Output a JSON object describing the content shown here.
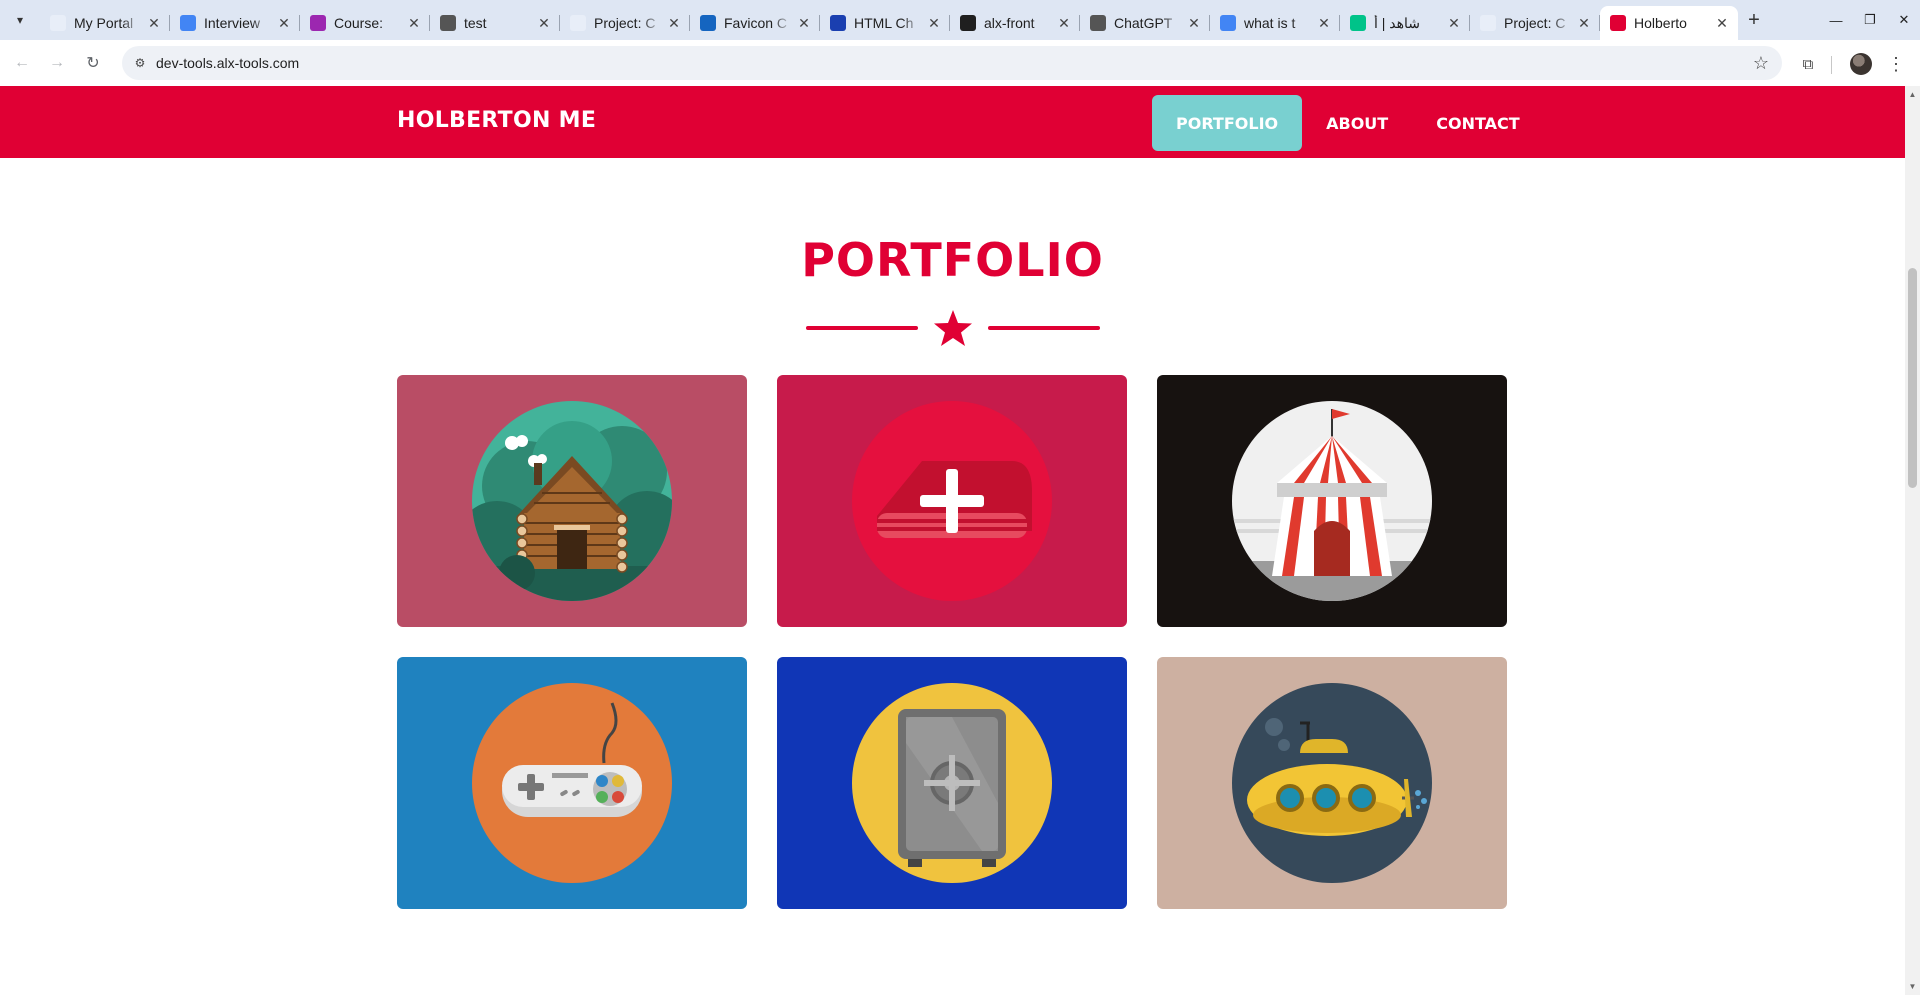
{
  "browser": {
    "tabs": [
      {
        "title": "My Portal",
        "favicon": "alx-icon",
        "color": "#e8eef8"
      },
      {
        "title": "Interview",
        "favicon": "google-icon",
        "color": "#4285f4"
      },
      {
        "title": "Course: ",
        "favicon": "course-icon",
        "color": "#9c27b0"
      },
      {
        "title": "test",
        "favicon": "globe-icon",
        "color": "#555555"
      },
      {
        "title": "Project: C",
        "favicon": "alx-icon",
        "color": "#e8eef8"
      },
      {
        "title": "Favicon C",
        "favicon": "favicon-icon",
        "color": "#1565c0"
      },
      {
        "title": "HTML Ch",
        "favicon": "html-icon",
        "color": "#1a3fb0"
      },
      {
        "title": "alx-front",
        "favicon": "github-icon",
        "color": "#1f1f1f"
      },
      {
        "title": "ChatGPT",
        "favicon": "chatgpt-icon",
        "color": "#555555"
      },
      {
        "title": "what is t",
        "favicon": "google-icon",
        "color": "#4285f4"
      },
      {
        "title": "شاهد | أ",
        "favicon": "shahid-icon",
        "color": "#00c389"
      },
      {
        "title": "Project: C",
        "favicon": "alx-icon",
        "color": "#e8eef8"
      },
      {
        "title": "Holberto",
        "favicon": "holberton-icon",
        "color": "#e00034",
        "active": true
      }
    ],
    "url": "dev-tools.alx-tools.com"
  },
  "site": {
    "brand": "HOLBERTON ME",
    "nav": [
      {
        "label": "PORTFOLIO",
        "active": true
      },
      {
        "label": "ABOUT",
        "active": false
      },
      {
        "label": "CONTACT",
        "active": false
      }
    ],
    "section_title": "PORTFOLIO",
    "accent_color": "#e00034",
    "active_nav_color": "#79d0d0",
    "portfolio": [
      {
        "icon": "cabin-icon",
        "bg": "#b94d65"
      },
      {
        "icon": "safe-box-icon",
        "bg": "#c71b4b"
      },
      {
        "icon": "circus-tent-icon",
        "bg": "#171210"
      },
      {
        "icon": "game-controller-icon",
        "bg": "#1f82bf"
      },
      {
        "icon": "vault-icon",
        "bg": "#1036b6"
      },
      {
        "icon": "submarine-icon",
        "bg": "#cdb0a1"
      }
    ]
  }
}
